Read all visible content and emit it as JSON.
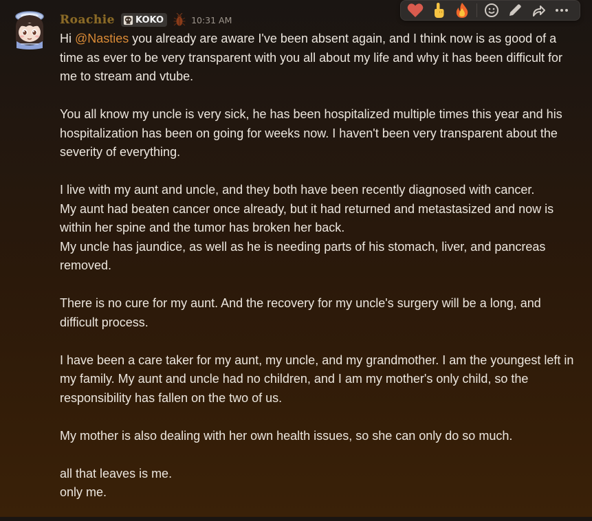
{
  "message": {
    "author": "Roachie",
    "tag": "KOKO",
    "timestamp": "10:31 AM",
    "greeting": "Hi ",
    "mention": "@Nasties",
    "first_paragraph_rest": " you already are aware I've been absent again, and I think now is as good of a time as ever to be very transparent with you all about my life and why it has been difficult for me to stream and vtube.",
    "paragraphs": [
      "You all know my uncle is very sick, he has been hospitalized multiple times this year and his hospitalization has been on going for weeks now. I haven't been very transparent about the severity of everything.",
      "I live with my aunt and uncle, and they both have been recently diagnosed with cancer.",
      "My aunt had beaten cancer once already, but it had returned and metastasized and now is within her spine and the tumor has broken her back.",
      "My uncle has jaundice, as well as he is needing parts of his stomach, liver, and pancreas removed.",
      "There is no cure for my aunt. And the recovery for my uncle's surgery will be a long, and difficult process.",
      "I have been a care taker for my aunt, my uncle, and my grandmother. I am the youngest left in my family. My aunt and uncle had no children, and I am my mother's only child, so the responsibility has fallen on the two of us.",
      "My mother is also dealing with her own health issues, so she can only do so much.",
      "all that leaves is me.",
      "only me."
    ]
  },
  "toolbar": {
    "reactions": [
      "heart-icon",
      "pointing-up-icon",
      "fire-icon"
    ],
    "actions": [
      "add-reaction-icon",
      "edit-icon",
      "reply-icon",
      "more-icon"
    ]
  },
  "colors": {
    "username": "#8a6a28",
    "mention": "#d98a36",
    "text": "#ece6de"
  }
}
